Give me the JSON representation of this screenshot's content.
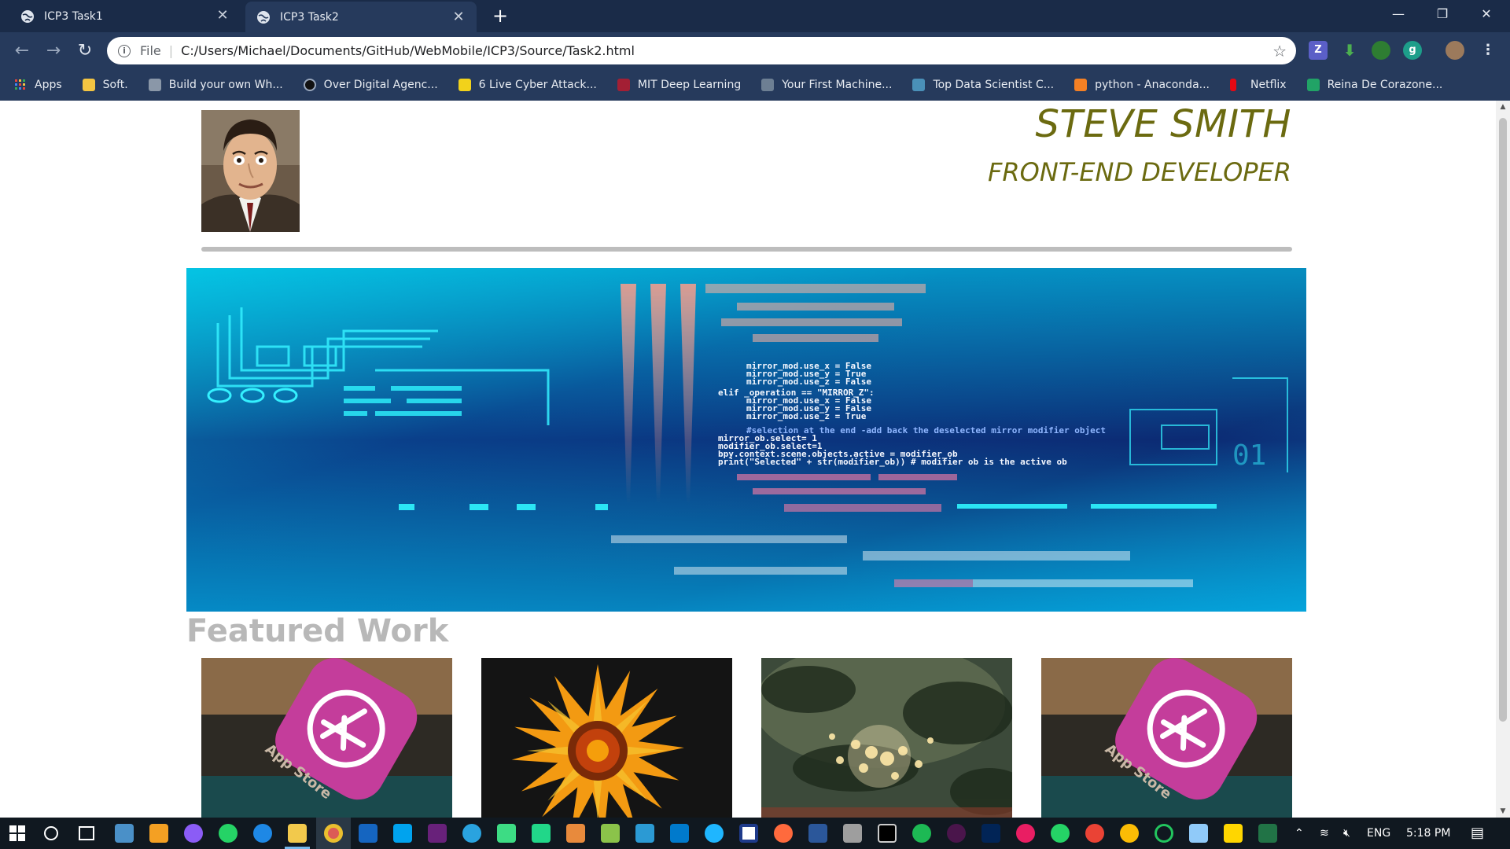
{
  "browser": {
    "tabs": [
      {
        "label": "ICP3 Task1",
        "active": false
      },
      {
        "label": "ICP3 Task2",
        "active": true
      }
    ],
    "new_tab_icon": "plus-icon",
    "window_controls": {
      "minimize": "—",
      "restore": "❐",
      "close": "✕"
    },
    "address": {
      "scheme": "File",
      "url": "C:/Users/Michael/Documents/GitHub/WebMobile/ICP3/Source/Task2.html"
    },
    "bookmarks": [
      {
        "label": "Apps",
        "icon": "apps-grid-icon",
        "color": "#e8453c"
      },
      {
        "label": "Soft.",
        "icon": "folder-icon",
        "color": "#f4c542"
      },
      {
        "label": "Build your own Wh...",
        "icon": "page-icon",
        "color": "#8a97a8"
      },
      {
        "label": "Over Digital Agenc...",
        "icon": "circle-logo-icon",
        "color": "#111111"
      },
      {
        "label": "6 Live Cyber Attack...",
        "icon": "s-logo-icon",
        "color": "#f2d21b"
      },
      {
        "label": "MIT Deep Learning",
        "icon": "mit-logo-icon",
        "color": "#a31f34"
      },
      {
        "label": "Your First Machine...",
        "icon": "page-icon",
        "color": "#6d7f93"
      },
      {
        "label": "Top Data Scientist C...",
        "icon": "chart-icon",
        "color": "#4a90b8"
      },
      {
        "label": "python - Anaconda...",
        "icon": "stack-icon",
        "color": "#f48024"
      },
      {
        "label": "Netflix",
        "icon": "netflix-icon",
        "color": "#e50914"
      },
      {
        "label": "Reina De Corazone...",
        "icon": "w-logo-icon",
        "color": "#21a366"
      }
    ]
  },
  "page": {
    "name": "STEVE SMITH",
    "title": "FRONT-END DEVELOPER",
    "featured_heading": "Featured Work",
    "accent_color": "#6b6a10",
    "heading_color": "#b8b8b8",
    "hero_code_lines": [
      "mirror_mod.use_x = False",
      "mirror_mod.use_y = True",
      "mirror_mod.use_z = False",
      "elif _operation == \"MIRROR_Z\":",
      "mirror_mod.use_x = False",
      "mirror_mod.use_y = False",
      "mirror_mod.use_z = True",
      "#selection at the end -add back the deselected mirror modifier object",
      "mirror_ob.select= 1",
      "modifier_ob.select=1",
      "bpy.context.scene.objects.active = modifier_ob",
      "print(\"Selected\" + str(modifier_ob)) # modifier ob is the active ob"
    ],
    "featured_items": [
      {
        "image": "app-store-icon",
        "label": "App Store"
      },
      {
        "image": "sunflower-image",
        "label": ""
      },
      {
        "image": "bokeh-lights-image",
        "label": ""
      },
      {
        "image": "app-store-icon",
        "label": "App Store"
      }
    ]
  },
  "taskbar": {
    "language": "ENG",
    "time": "5:18 PM"
  }
}
